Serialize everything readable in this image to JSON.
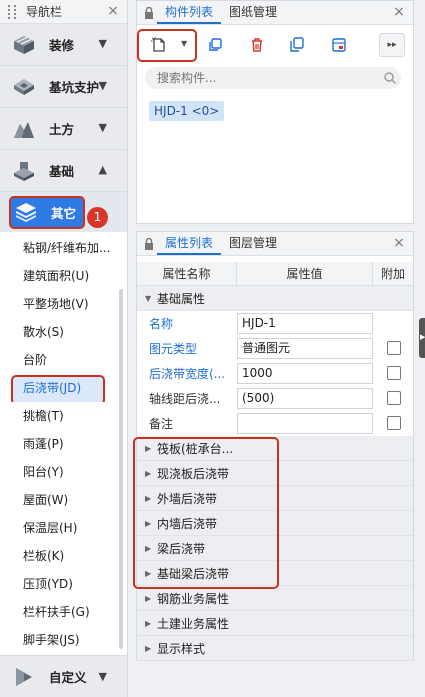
{
  "nav": {
    "title": "导航栏",
    "close": "×",
    "groups": [
      {
        "label": "装修",
        "icon": "decoration-icon"
      },
      {
        "label": "基坑支护",
        "icon": "foundation-pit-icon"
      },
      {
        "label": "土方",
        "icon": "earthwork-icon"
      },
      {
        "label": "基础",
        "icon": "foundation-icon"
      }
    ],
    "active_group": {
      "label": "其它",
      "icon": "layers-icon"
    },
    "badge": "1",
    "sub_items": [
      "粘钢/纤维布加...",
      "建筑面积(U)",
      "平整场地(V)",
      "散水(S)",
      "台阶",
      "后浇带(JD)",
      "挑檐(T)",
      "雨蓬(P)",
      "阳台(Y)",
      "屋面(W)",
      "保温层(H)",
      "栏板(K)",
      "压顶(YD)",
      "栏杆扶手(G)",
      "脚手架(JS)"
    ],
    "selected_sub": "后浇带(JD)",
    "bottom_group": {
      "label": "自定义",
      "icon": "custom-icon"
    }
  },
  "component_panel": {
    "tabs": [
      "构件列表",
      "图纸管理"
    ],
    "active_tab": "构件列表",
    "close": "×",
    "more": "▸▸",
    "search_placeholder": "搜索构件...",
    "chip": "HJD-1 <0>"
  },
  "property_panel": {
    "tabs": [
      "属性列表",
      "图层管理"
    ],
    "active_tab": "属性列表",
    "close": "×",
    "headers": [
      "属性名称",
      "属性值",
      "附加"
    ],
    "group_title": "基础属性",
    "rows": [
      {
        "label": "名称",
        "value": "HJD-1",
        "blue": true,
        "check": false
      },
      {
        "label": "图元类型",
        "value": "普通图元",
        "blue": true,
        "check": true
      },
      {
        "label": "后浇带宽度(...",
        "value": "1000",
        "blue": true,
        "check": true
      },
      {
        "label": "轴线距后浇...",
        "value": "(500)",
        "blue": false,
        "check": true
      },
      {
        "label": "备注",
        "value": "",
        "blue": false,
        "check": true
      }
    ],
    "sections": [
      "筏板(桩承台...",
      "现浇板后浇带",
      "外墙后浇带",
      "内墙后浇带",
      "梁后浇带",
      "基础梁后浇带",
      "钢筋业务属性",
      "土建业务属性",
      "显示样式"
    ]
  },
  "colors": {
    "accent": "#1f6fd1",
    "highlight": "#c9321f",
    "active_bg": "#2f7be6"
  }
}
